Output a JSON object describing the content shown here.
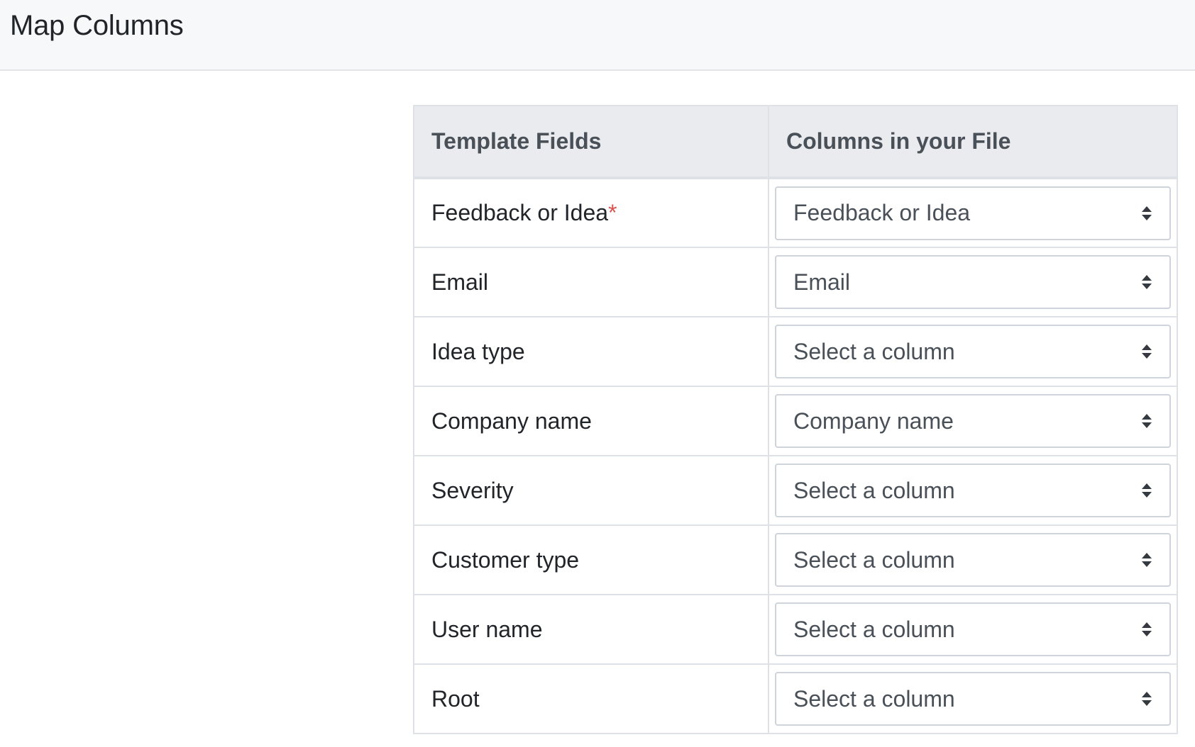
{
  "header": {
    "title": "Map Columns"
  },
  "table": {
    "headers": {
      "template_fields": "Template Fields",
      "columns_in_file": "Columns in your File"
    },
    "rows": [
      {
        "field": "Feedback or Idea",
        "required_mark": "*",
        "selected": "Feedback or Idea"
      },
      {
        "field": "Email",
        "required_mark": "",
        "selected": "Email"
      },
      {
        "field": "Idea type",
        "required_mark": "",
        "selected": "Select a column"
      },
      {
        "field": "Company name",
        "required_mark": "",
        "selected": "Company name"
      },
      {
        "field": "Severity",
        "required_mark": "",
        "selected": "Select a column"
      },
      {
        "field": "Customer type",
        "required_mark": "",
        "selected": "Select a column"
      },
      {
        "field": "User name",
        "required_mark": "",
        "selected": "Select a column"
      },
      {
        "field": "Root",
        "required_mark": "",
        "selected": "Select a column"
      }
    ]
  },
  "icons": {
    "select_arrows": "sort-arrows-icon"
  },
  "colors": {
    "required": "#d9534f",
    "header_bg": "#f7f8fa",
    "table_header_bg": "#e9ebee"
  }
}
